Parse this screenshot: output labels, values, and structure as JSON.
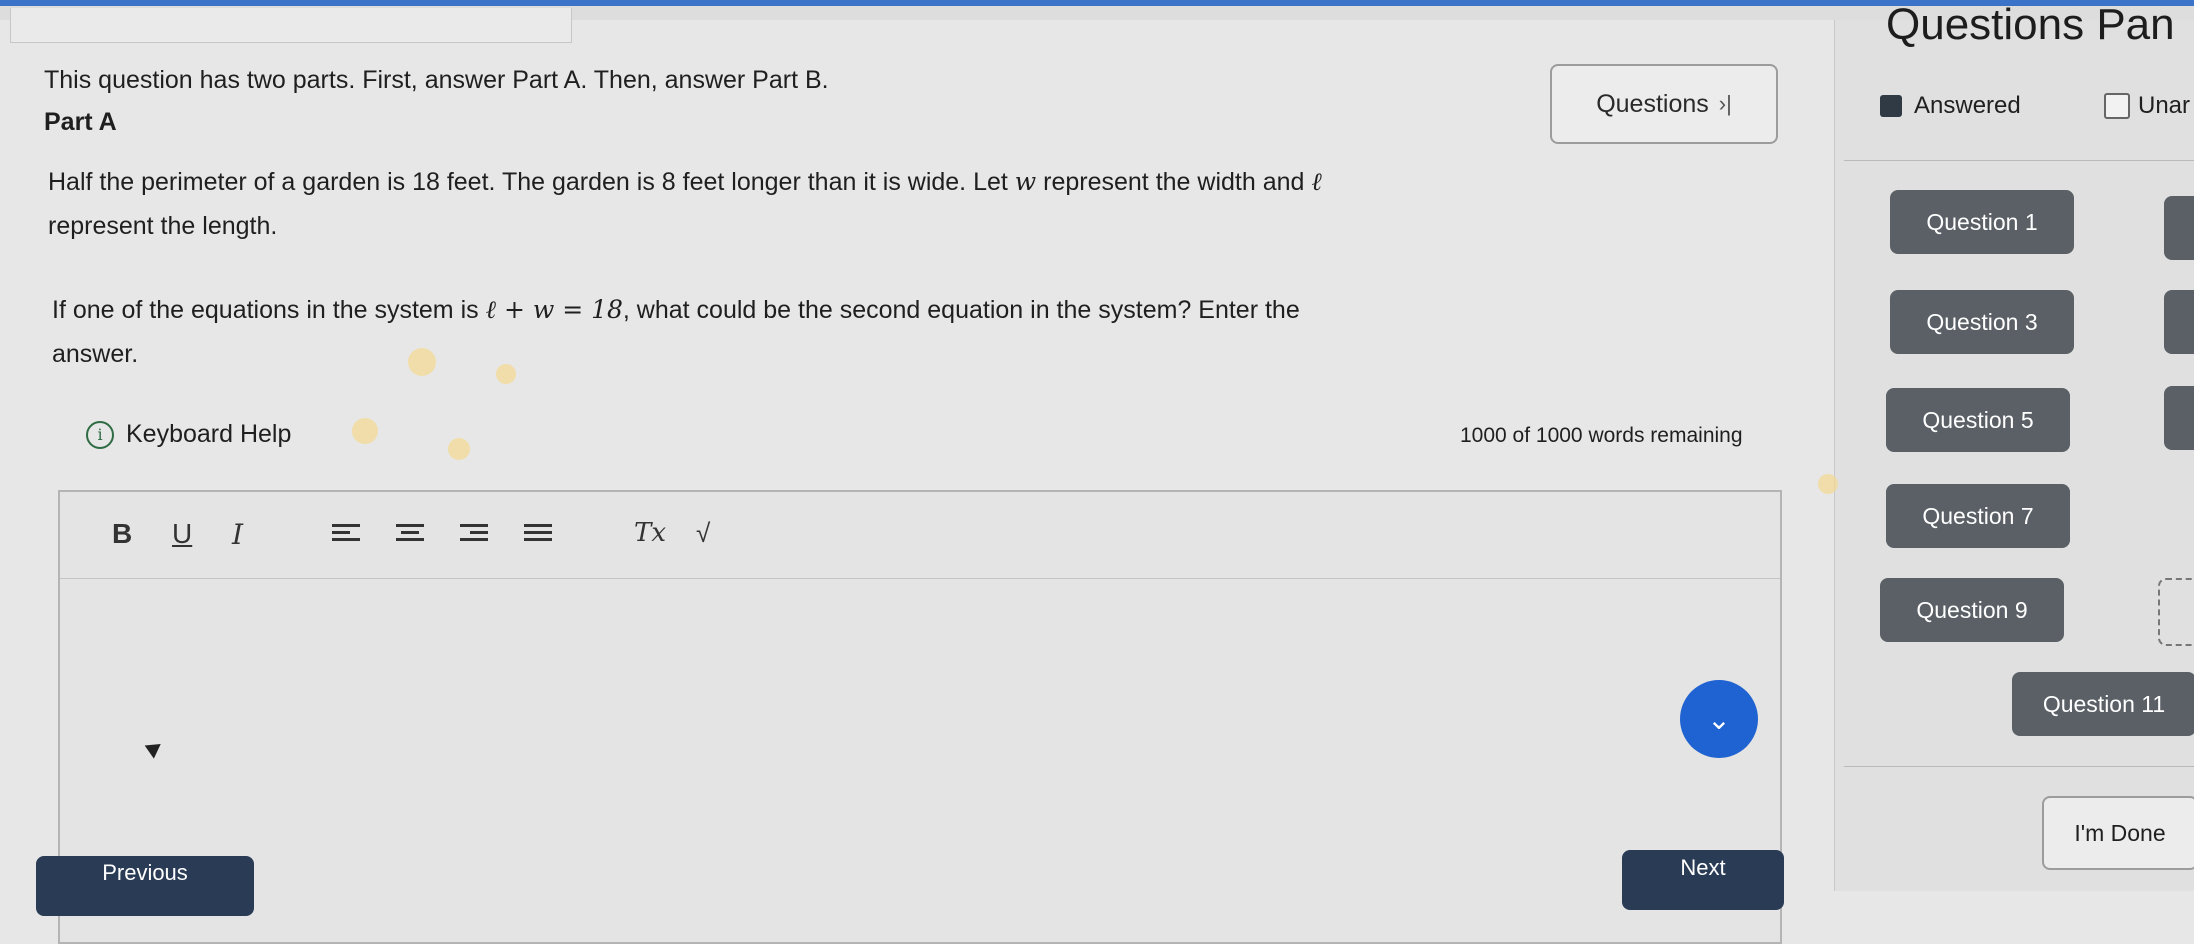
{
  "panel": {
    "title": "Questions Pan",
    "legend_answered": "Answered",
    "legend_unanswered": "Unar",
    "questions": [
      "Question 1",
      "Question 3",
      "Question 5",
      "Question 7",
      "Question 9",
      "Question 11"
    ],
    "done_label": "I'm Done"
  },
  "main": {
    "intro": "This question has two parts. First, answer Part A. Then, answer Part B.",
    "part": "Part A",
    "questions_button": "Questions",
    "questions_button_glyph": "›|",
    "problem_line1": "Half the perimeter of a garden is 18 feet. The garden is 8 feet longer than it is wide. Let",
    "var_w": "w",
    "problem_line1b": "represent the width and",
    "var_l": "ℓ",
    "problem_line2": "represent the length.",
    "q_before": "If one of the equations in the system is",
    "equation": "ℓ + w = 18",
    "q_after": ", what could be the second equation in the system? Enter the",
    "q_line2": "answer.",
    "keyboard_help": "Keyboard Help",
    "words_remaining": "1000 of 1000 words remaining"
  },
  "toolbar": {
    "bold": "B",
    "underline": "U",
    "italic": "I",
    "clear_format": "Tx",
    "sqrt": "√"
  },
  "nav": {
    "previous": "Previous",
    "next": "Next"
  },
  "colors": {
    "accent": "#1f62d1",
    "question_button": "#5a6066",
    "nav_button": "#2a3b56"
  }
}
